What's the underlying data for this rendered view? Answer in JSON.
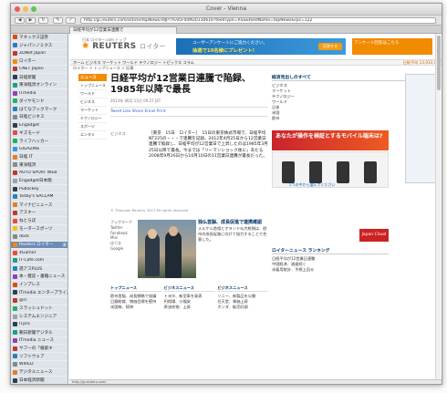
{
  "window": {
    "title": "Cover - Vienna"
  },
  "toolbar": {
    "url": "http://jp.reuters.com/article/topNews/idJPTYE95F00M20130616?feedType=RSS&feedName=topNews&rpc=122"
  },
  "tab": {
    "label": "日経平均が12営業日連騰で"
  },
  "sidebar": {
    "items": [
      {
        "label": "マネックス証券",
        "color": "#d35400",
        "count": ""
      },
      {
        "label": "ジャパンノミクス",
        "color": "#2980b9",
        "count": ""
      },
      {
        "label": "ZDNet Japan",
        "color": "#c0392b",
        "count": ""
      },
      {
        "label": "ロイター",
        "color": "#f18b00",
        "count": ""
      },
      {
        "label": "CNET Japan",
        "color": "#c0392b",
        "count": ""
      },
      {
        "label": "日経新聞",
        "color": "#2c3e50",
        "count": ""
      },
      {
        "label": "東洋経済オンライン",
        "color": "#16a085",
        "count": ""
      },
      {
        "label": "ITmedia",
        "color": "#8e44ad",
        "count": ""
      },
      {
        "label": "ダイヤモンド",
        "color": "#27ae60",
        "count": ""
      },
      {
        "label": "はてなブックマーク",
        "color": "#2980b9",
        "count": ""
      },
      {
        "label": "日経ビジネス",
        "color": "#7f8c8d",
        "count": ""
      },
      {
        "label": "Engadget",
        "color": "#2c3e50",
        "count": ""
      },
      {
        "label": "ギズモード",
        "color": "#e74c3c",
        "count": ""
      },
      {
        "label": "ライフハッカー",
        "color": "#27ae60",
        "count": ""
      },
      {
        "label": "GIGAZINE",
        "color": "#3498db",
        "count": ""
      },
      {
        "label": "日経 IT",
        "color": "#e67e22",
        "count": ""
      },
      {
        "label": "東洋経済",
        "color": "#7f8c8d",
        "count": ""
      },
      {
        "label": "AUTO SPORT WEB",
        "color": "#c0392b",
        "count": ""
      },
      {
        "label": "Engadget日本版",
        "color": "#95a5a6",
        "count": ""
      },
      {
        "label": "Publickey",
        "color": "#2c3e50",
        "count": ""
      },
      {
        "label": "Today's SACLAM",
        "color": "#2980b9",
        "count": ""
      },
      {
        "label": "マイナビニュース",
        "color": "#e67e22",
        "count": ""
      },
      {
        "label": "アスキー",
        "color": "#c0392b",
        "count": ""
      },
      {
        "label": "ねとらぼ",
        "color": "#e74c3c",
        "count": ""
      },
      {
        "label": "モータースポーツ",
        "color": "#f1c40f",
        "count": ""
      },
      {
        "label": "dock",
        "color": "#7f8c8d",
        "count": ""
      },
      {
        "label": "Reuters ロイター",
        "color": "#f18b00",
        "count": "4"
      },
      {
        "label": "4Gamer",
        "color": "#e74c3c",
        "count": ""
      },
      {
        "label": "IT-Cafe.com",
        "color": "#16a085",
        "count": ""
      },
      {
        "label": "週アスPLUS",
        "color": "#2980b9",
        "count": ""
      },
      {
        "label": "本・雑誌・書籍ニュース",
        "color": "#8e44ad",
        "count": ""
      },
      {
        "label": "インプレス",
        "color": "#d35400",
        "count": ""
      },
      {
        "label": "ITmedia エンタープライズ",
        "color": "#2c3e50",
        "count": ""
      },
      {
        "label": "@IT",
        "color": "#c0392b",
        "count": ""
      },
      {
        "label": "スラッシュドット",
        "color": "#27ae60",
        "count": ""
      },
      {
        "label": "システムエンジニア",
        "color": "#95a5a6",
        "count": ""
      },
      {
        "label": "ITpro",
        "color": "#2c3e50",
        "count": ""
      },
      {
        "label": "朝日新聞デジタル",
        "color": "#16a085",
        "count": ""
      },
      {
        "label": "ITmedia ニュース",
        "color": "#8e44ad",
        "count": ""
      },
      {
        "label": "ヤフーの「検索キ",
        "color": "#c0392b",
        "count": ""
      },
      {
        "label": "ソフトウェア",
        "color": "#2980b9",
        "count": ""
      },
      {
        "label": "WIRED",
        "color": "#7f8c8d",
        "count": ""
      },
      {
        "label": "デジタルニュース",
        "color": "#e67e22",
        "count": ""
      },
      {
        "label": "日本経済新聞",
        "color": "#2c3e50",
        "count": ""
      }
    ]
  },
  "header": {
    "langs": "日本  ロイター.com  トップ",
    "logo_main": "REUTERS",
    "logo_jp": "ロイター",
    "ad_line1": "ユーザーアンケートにご協力ください。",
    "ad_line2": "抽選で10名様にプレゼント!",
    "ad_btn": "回答する",
    "ad_right": "アンケート回答はこちら"
  },
  "nav": {
    "path": "ホーム  ビジネス  マーケット  ワールド  テクノロジー  トピックス  コラム",
    "right": "日経平均 13,033.12"
  },
  "subnav": {
    "text": "ロイター  >  トップニュース  >  記事"
  },
  "left": {
    "heading": "ニュース",
    "items": [
      "トップニュース",
      "ワールド",
      "ビジネス",
      "マーケット",
      "テクノロジー",
      "スポーツ",
      "エンタメ"
    ]
  },
  "article": {
    "headline": "日経平均が12営業日連騰で陥録、1985年以降で最長",
    "meta": "2013年 06月 15日 09:27 JST",
    "share": "Tweet  Like  Share  Email  Print",
    "side": "ビジネス",
    "body": "［東京　15日　ロイター］　15日の東京株式市場で、日経平均NT225の・・・で連騰を記録。2012年4月25日から12営業日連騰で陥録し、日経平均が12営業日で上昇したのは1985年3月25日以降で最長。今までは「リーマンショック後に」あたる2008年9月26日から10月10日の11営業日連騰が最長だった。",
    "copyright": "© Thomson Reuters 2013 All rights reserved",
    "photo_title": "独仏首脳、成長促進で連携確認",
    "photo_text": "メルケル首相とオランド仏大統領は、欧州の成長促進に向けて協力することで合意した。",
    "tags": [
      "ブックマーク",
      "Twitter",
      "Facebook",
      "Mixi",
      "はてな",
      "Google"
    ]
  },
  "sections": [
    {
      "heading": "トップニュース",
      "items": [
        "欧州首脳、成長戦略で協議",
        "日銀総裁、物価目標を堅持",
        "米国株、続伸"
      ]
    },
    {
      "heading": "ビジネスニュース",
      "items": [
        "トヨタ、新型車を発表",
        "円相場、小幅安",
        "原油先物、上昇"
      ]
    },
    {
      "heading": "ビジネスニュース",
      "items": [
        "ソニー、新製品を公開",
        "任天堂、株価上昇",
        "ホンダ、販売好調"
      ]
    }
  ],
  "right": {
    "heading": "経済見出しのすべて",
    "items": [
      "ビジネス",
      "マーケット",
      "テクノロジー",
      "ワールド",
      "日本",
      "米国",
      "欧州"
    ],
    "ad3": "あなたが操作を検証とするモバイル端末は?",
    "phones_caption": "5つの中から選んでください",
    "jp_ad": "Japan Cloud",
    "bottom_heading": "ロイターニュース ランキング",
    "bottom_items": [
      "日経平均が12営業日連騰",
      "中国経済、減速続く",
      "米雇用統計、予想上回る"
    ]
  },
  "status": {
    "text": "http://jp.reuters.com/"
  },
  "colors": {
    "accent": "#f18b00",
    "link": "#003366"
  }
}
